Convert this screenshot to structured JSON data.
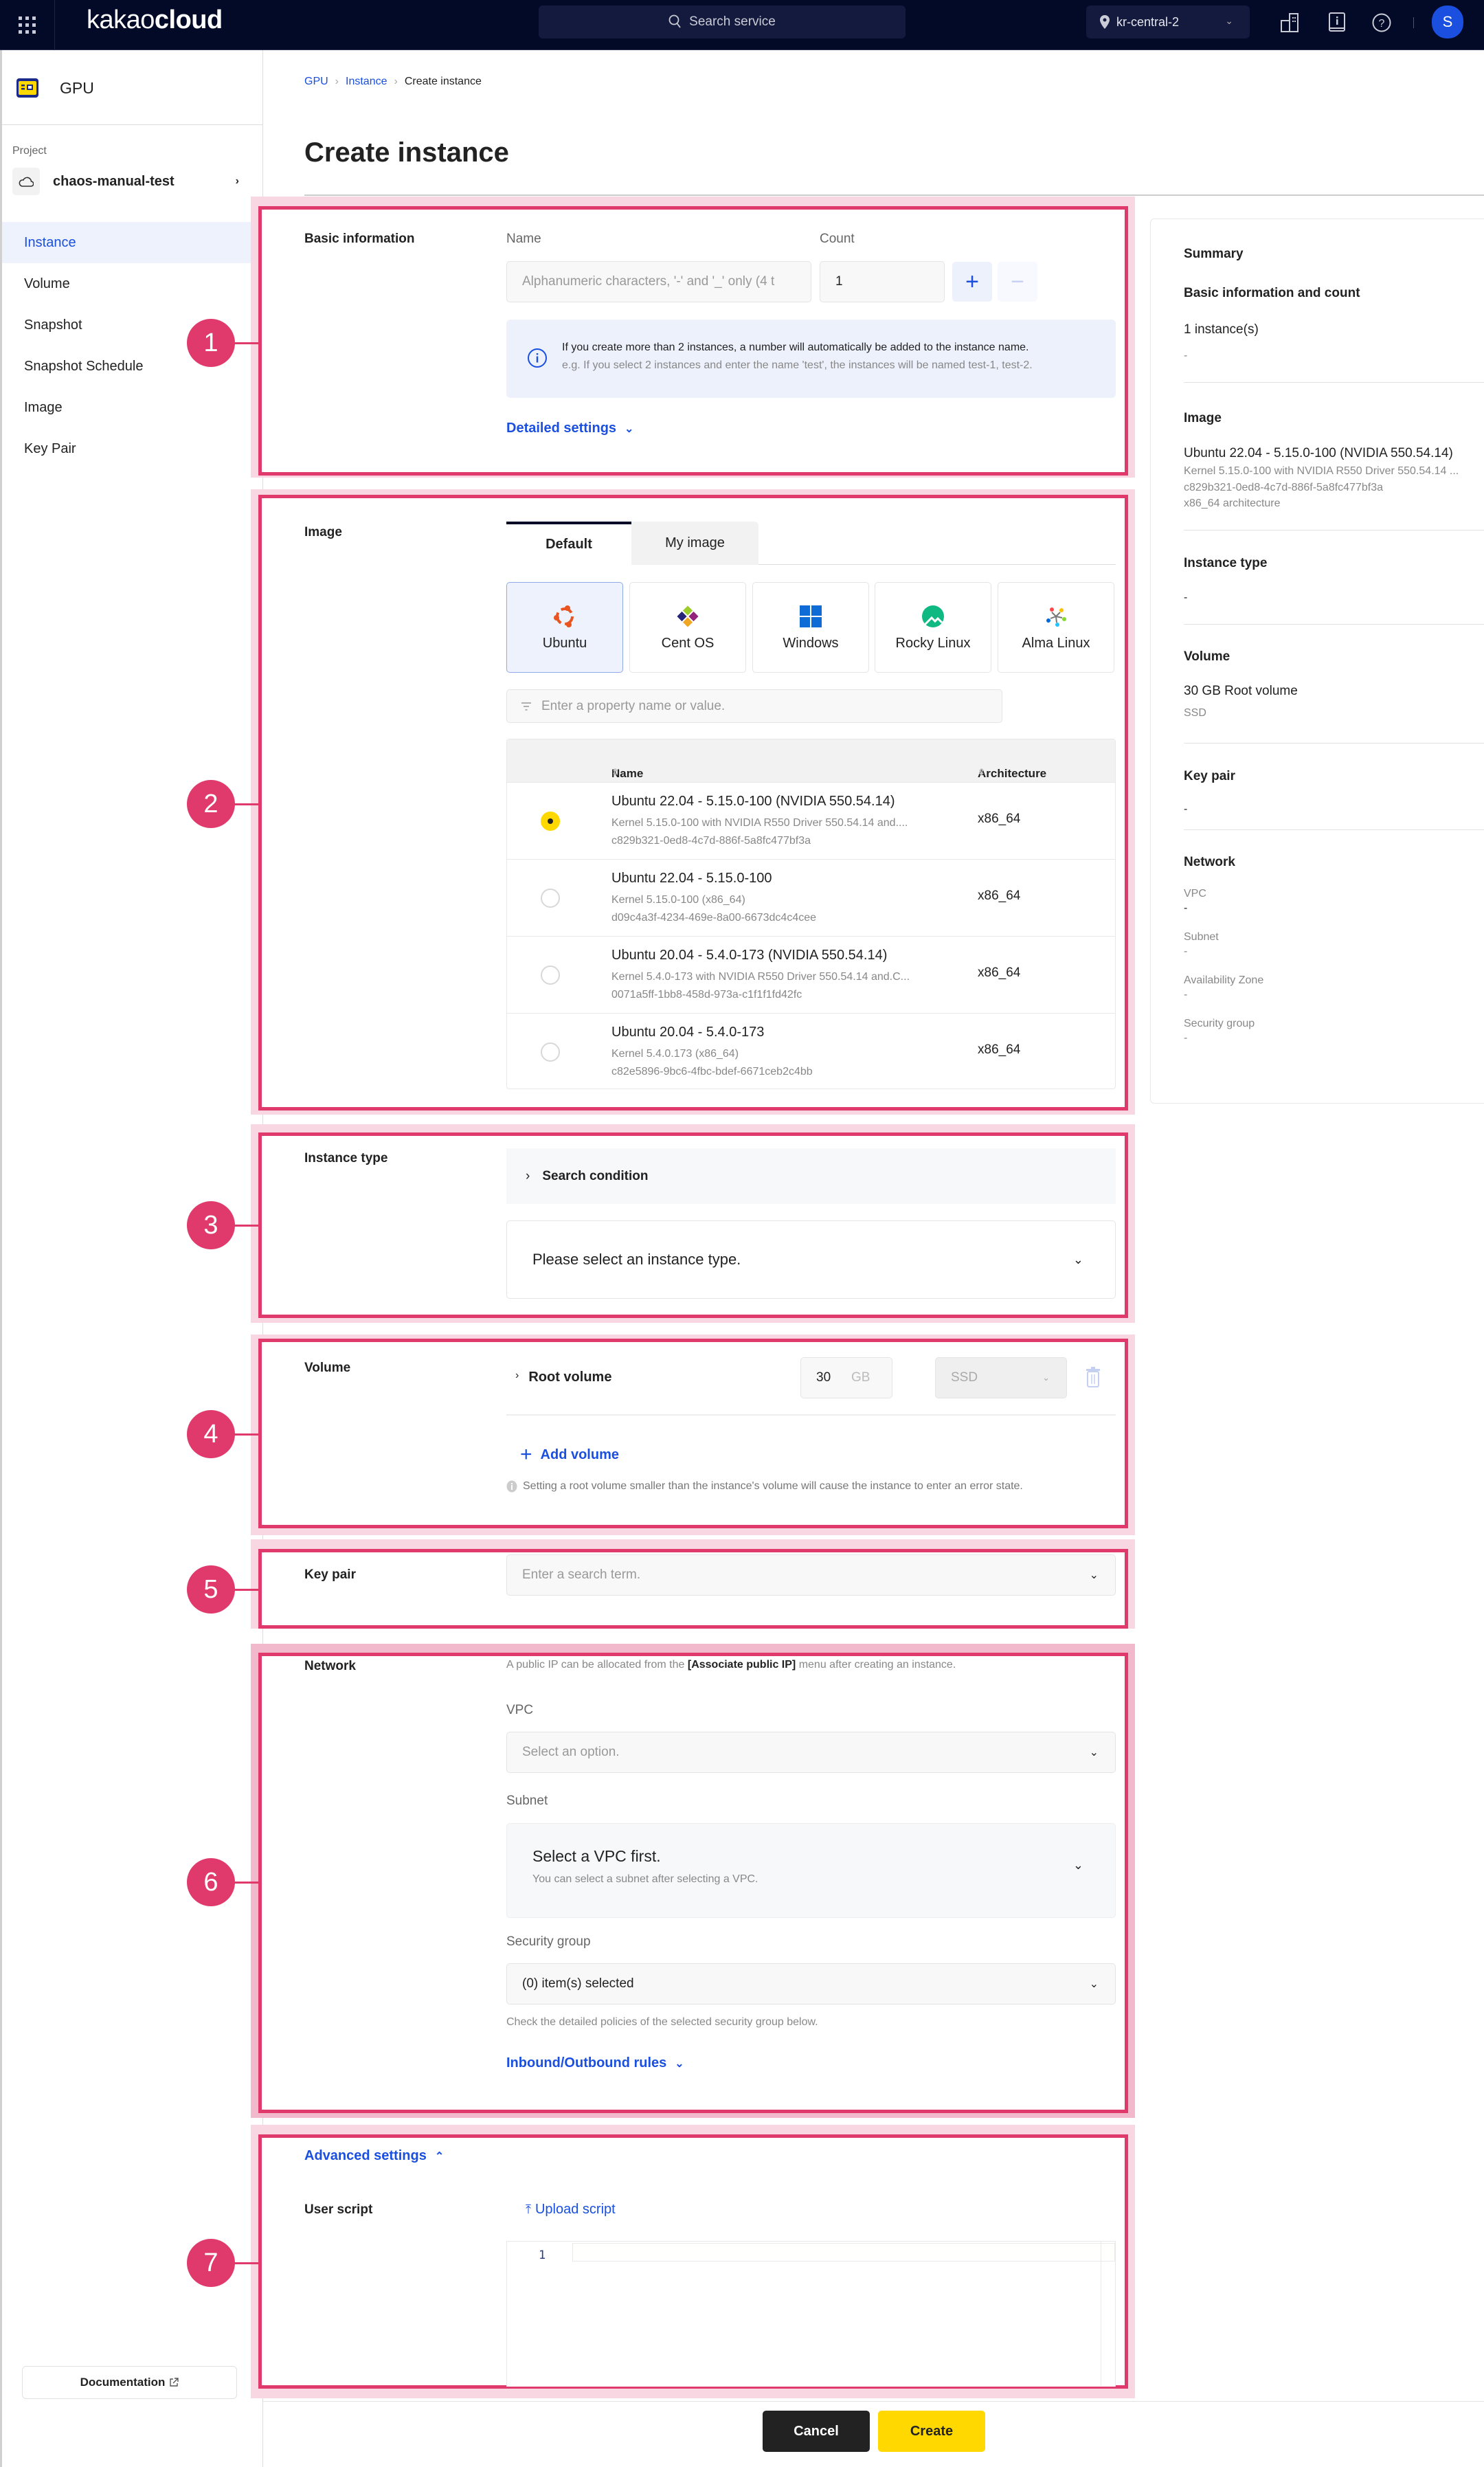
{
  "topbar": {
    "logo_light": "kakao",
    "logo_bold": "cloud",
    "search_placeholder": "Search service",
    "region": "kr-central-2",
    "avatar_initial": "S",
    "icons": [
      "apps-grid-icon",
      "search-icon",
      "location-pin-icon",
      "building-icon",
      "info-book-icon",
      "help-icon"
    ]
  },
  "sidebar": {
    "service_name": "GPU",
    "project_label": "Project",
    "project_name": "chaos-manual-test",
    "items": [
      {
        "label": "Instance",
        "active": true
      },
      {
        "label": "Volume",
        "active": false
      },
      {
        "label": "Snapshot",
        "active": false
      },
      {
        "label": "Snapshot Schedule",
        "active": false
      },
      {
        "label": "Image",
        "active": false
      },
      {
        "label": "Key Pair",
        "active": false
      }
    ],
    "documentation_label": "Documentation"
  },
  "breadcrumb": [
    "GPU",
    "Instance",
    "Create instance"
  ],
  "page_title": "Create instance",
  "annotations": [
    "1",
    "2",
    "3",
    "4",
    "5",
    "6",
    "7"
  ],
  "basic_info": {
    "section_label": "Basic information",
    "name_label": "Name",
    "name_placeholder": "Alphanumeric characters, '-' and '_' only (4 t",
    "count_label": "Count",
    "count_value": "1",
    "plus": "+",
    "minus": "−",
    "info_title": "If you create more than 2 instances, a number will automatically be added to the instance name.",
    "info_example": "e.g. If you select 2 instances and enter the name 'test', the instances will be named test-1, test-2.",
    "detailed_settings": "Detailed settings"
  },
  "image": {
    "section_label": "Image",
    "tabs": [
      "Default",
      "My image"
    ],
    "os_options": [
      "Ubuntu",
      "Cent OS",
      "Windows",
      "Rocky Linux",
      "Alma Linux"
    ],
    "selected_os": "Ubuntu",
    "filter_placeholder": "Enter a property name or value.",
    "columns": [
      "Name",
      "Architecture"
    ],
    "rows": [
      {
        "name": "Ubuntu 22.04 - 5.15.0-100 (NVIDIA 550.54.14)",
        "desc": "Kernel 5.15.0-100 with NVIDIA R550 Driver 550.54.14 and....",
        "id": "c829b321-0ed8-4c7d-886f-5a8fc477bf3a",
        "arch": "x86_64",
        "selected": true
      },
      {
        "name": "Ubuntu 22.04 - 5.15.0-100",
        "desc": "Kernel 5.15.0-100 (x86_64)",
        "id": "d09c4a3f-4234-469e-8a00-6673dc4c4cee",
        "arch": "x86_64",
        "selected": false
      },
      {
        "name": "Ubuntu 20.04 - 5.4.0-173 (NVIDIA 550.54.14)",
        "desc": "Kernel 5.4.0-173 with NVIDIA R550 Driver 550.54.14 and.C...",
        "id": "0071a5ff-1bb8-458d-973a-c1f1f1fd42fc",
        "arch": "x86_64",
        "selected": false
      },
      {
        "name": "Ubuntu 20.04 - 5.4.0-173",
        "desc": "Kernel 5.4.0.173 (x86_64)",
        "id": "c82e5896-9bc6-4fbc-bdef-6671ceb2c4bb",
        "arch": "x86_64",
        "selected": false
      }
    ]
  },
  "instance_type": {
    "section_label": "Instance type",
    "search_condition": "Search condition",
    "select_placeholder": "Please select an instance type."
  },
  "volume": {
    "section_label": "Volume",
    "root_volume_label": "Root volume",
    "size_value": "30",
    "size_unit": "GB",
    "type_value": "SSD",
    "add_volume": "Add volume",
    "warning": "Setting a root volume smaller than the instance's volume will cause the instance to enter an error state."
  },
  "key_pair": {
    "section_label": "Key pair",
    "placeholder": "Enter a search term."
  },
  "network": {
    "section_label": "Network",
    "note_prefix": "A public IP can be allocated from the ",
    "note_bold": "[Associate public IP]",
    "note_suffix": " menu after creating an instance.",
    "vpc_label": "VPC",
    "vpc_placeholder": "Select an option.",
    "subnet_label": "Subnet",
    "subnet_title": "Select a VPC first.",
    "subnet_hint": "You can select a subnet after selecting a VPC.",
    "sg_label": "Security group",
    "sg_value": "(0) item(s) selected",
    "sg_hint": "Check the detailed policies of the selected security group below.",
    "rules_link": "Inbound/Outbound rules"
  },
  "advanced": {
    "toggle_label": "Advanced settings",
    "user_script_label": "User script",
    "upload_script": "Upload script",
    "line_number": "1"
  },
  "summary": {
    "title": "Summary",
    "basic_heading": "Basic information and count",
    "basic_count": "1 instance(s)",
    "basic_name": "-",
    "image_heading": "Image",
    "image_name": "Ubuntu 22.04 - 5.15.0-100 (NVIDIA 550.54.14)",
    "image_desc": "Kernel 5.15.0-100 with NVIDIA R550 Driver 550.54.14 ...",
    "image_id": "c829b321-0ed8-4c7d-886f-5a8fc477bf3a",
    "image_arch": "x86_64 architecture",
    "type_heading": "Instance type",
    "type_value": "-",
    "volume_heading": "Volume",
    "volume_value": "30 GB Root volume",
    "volume_type": "SSD",
    "keypair_heading": "Key pair",
    "keypair_value": "-",
    "network_heading": "Network",
    "vpc_label": "VPC",
    "vpc_value": "-",
    "subnet_label": "Subnet",
    "subnet_value": "-",
    "az_label": "Availability Zone",
    "az_value": "-",
    "sg_label": "Security group",
    "sg_value": "-"
  },
  "footer": {
    "cancel": "Cancel",
    "create": "Create"
  },
  "colors": {
    "accent_blue": "#1a4fe0",
    "annotation_pink": "#e03a6c",
    "primary_yellow": "#ffd800",
    "topbar_navy": "#020a28"
  }
}
